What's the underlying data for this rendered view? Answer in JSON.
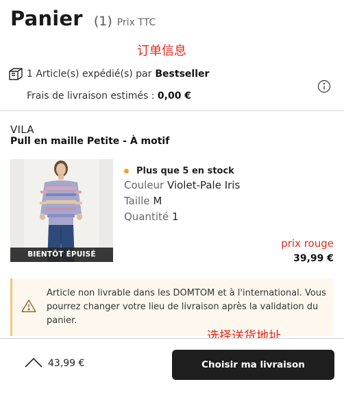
{
  "header": {
    "title": "Panier",
    "count": "(1)",
    "price_note": "Prix TTC"
  },
  "annotations": {
    "order_info": "订单信息",
    "choose_shipping": "选择送货地址"
  },
  "shipping": {
    "shipped_by_text": "1 Article(s) expédié(s) par",
    "seller": "Bestseller",
    "fees_label": "Frais de livraison estimés :",
    "fees_value": "0,00 €"
  },
  "item": {
    "brand": "VILA",
    "name": "Pull en maille Petite - À motif",
    "image_badge": "BIENTÔT ÉPUISÉ",
    "stock": "Plus que 5 en stock",
    "color_label": "Couleur",
    "color_value": "Violet-Pale Iris",
    "size_label": "Taille",
    "size_value": "M",
    "qty_label": "Quantité",
    "qty_value": "1",
    "price_note": "prix rouge",
    "price": "39,99 €"
  },
  "notice": {
    "text": "Article non livrable dans les DOMTOM et à l'international. Vous pourrez changer votre lieu de livraison après la validation du panier."
  },
  "footer": {
    "total": "43,99 €",
    "cta_label": "Choisir ma livraison"
  },
  "colors": {
    "accent_red": "#e02a1e",
    "stock_dot": "#f0a030",
    "cta_bg": "#1e1e1e",
    "notice_border": "#f3c680"
  }
}
